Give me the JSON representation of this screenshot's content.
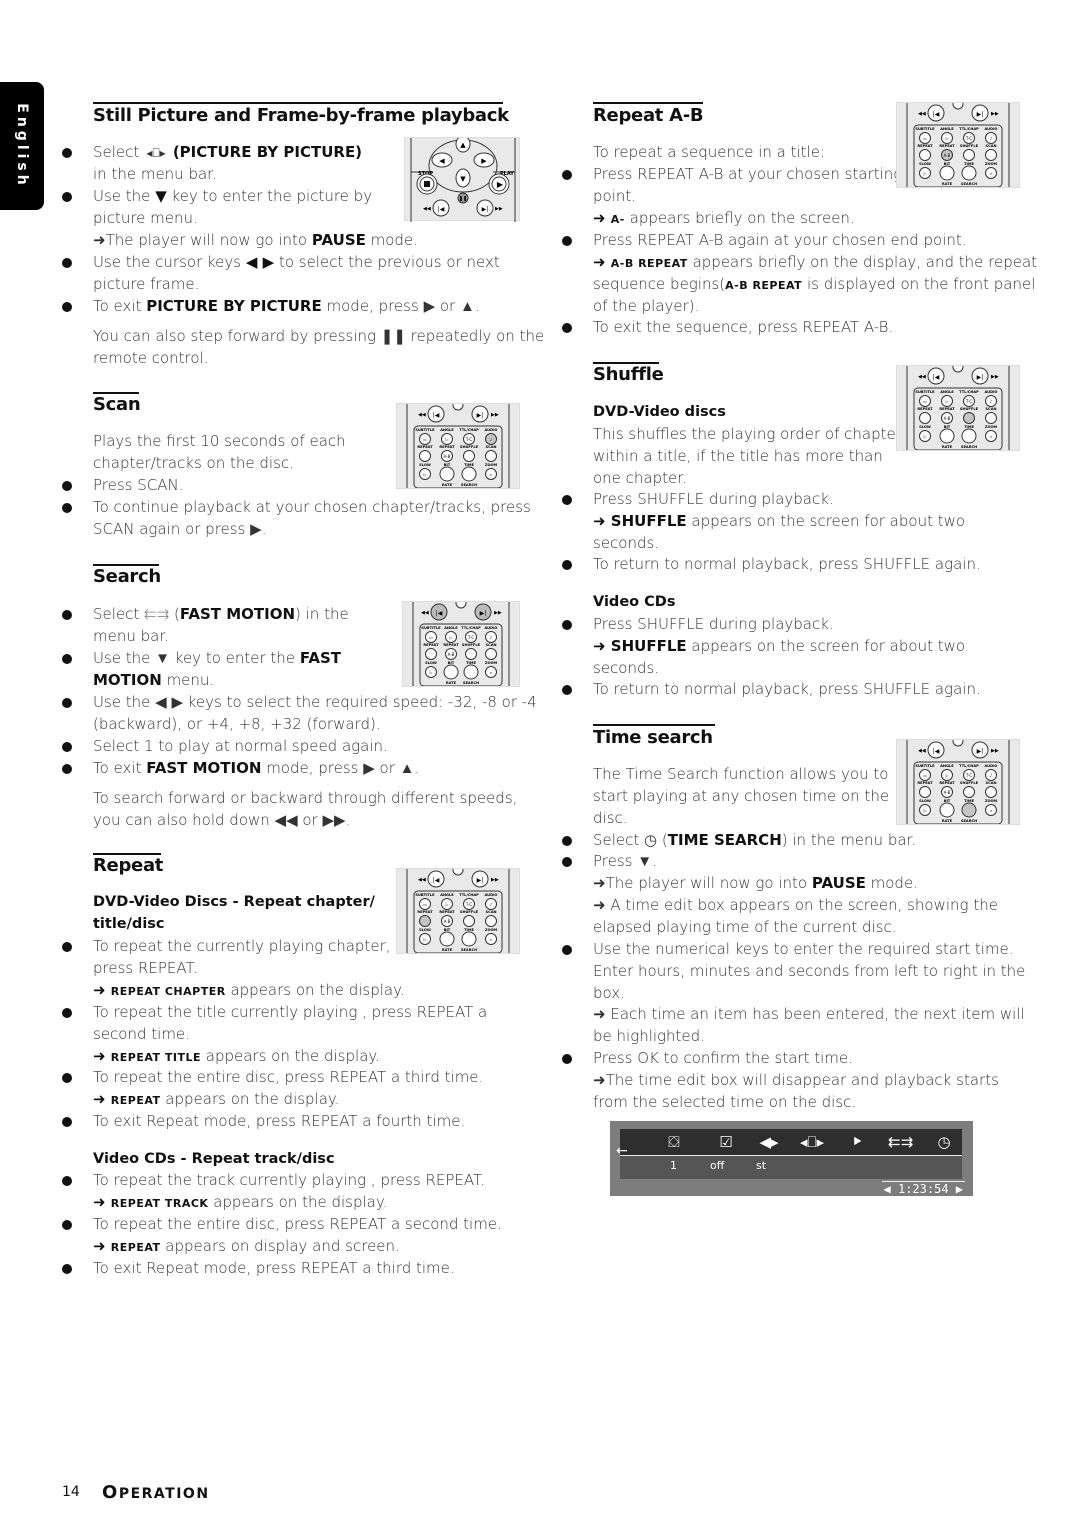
{
  "language_tab": "English",
  "footer": {
    "page_number": "14",
    "section_first": "O",
    "section_rest": "PERATION"
  },
  "still_picture": {
    "title": "Still Picture and Frame-by-frame playback",
    "lines": [
      {
        "pre": "Select ",
        "icon": "picture-by-picture-icon",
        "bold": "(PICTURE BY PICTURE)",
        "post": ""
      },
      {
        "text": "in the menu bar."
      },
      {
        "pre": "Use the ",
        "sym": "▼",
        "post": " key to enter the picture by"
      },
      {
        "text": "picture menu."
      },
      {
        "pre": "➜The player will now go into ",
        "bold": "PAUSE",
        "post": " mode."
      },
      {
        "pre": "Use the cursor keys ",
        "sym": "◀ ▶",
        "post": " to select the previous or next"
      },
      {
        "text": "picture frame."
      },
      {
        "pre": "To exit ",
        "bold": "PICTURE BY PICTURE",
        "post": " mode, press ▶ or ▲."
      },
      {
        "text": "You can also step forward by pressing ❚❚ repeatedly on the"
      },
      {
        "text": "remote control."
      }
    ],
    "remote_labels": {
      "stop": "STOP",
      "play": "PLAY"
    }
  },
  "scan": {
    "title": "Scan",
    "lines": [
      "Plays the first 10 seconds of each",
      "chapter/tracks on the disc.",
      "Press SCAN.",
      "To continue playback at your chosen chapter/tracks, press",
      "SCAN again or press ▶."
    ]
  },
  "search": {
    "title": "Search",
    "l1_pre": "Select ",
    "l1_bold": "FAST MOTION",
    "l1_post": ") in the",
    "l2": "menu bar.",
    "l3_pre": "Use the ▼ key to enter the ",
    "l3_bold": "FAST",
    "l4_bold": "MOTION",
    "l4_post": " menu.",
    "l5": "Use the ◀ ▶ keys to select the required speed: -32, -8 or -4",
    "l6": "(backward), or +4, +8, +32 (forward).",
    "l7": "Select 1 to play at normal speed again.",
    "l8_pre": "To exit ",
    "l8_bold": "FAST MOTION",
    "l8_post": " mode, press ▶ or ▲.",
    "l9": "To search forward or backward through different speeds,",
    "l10": "you can also hold down ◀◀ or ▶▶."
  },
  "repeat": {
    "title": "Repeat",
    "sub1_a": "DVD-Video Discs - Repeat chapter/",
    "sub1_b": "title/disc",
    "l1": "To repeat the currently playing chapter,",
    "l2": "press REPEAT.",
    "l3_sc": "REPEAT CHAPTER",
    "l3_post": " appears on the display.",
    "l4": "To repeat the title currently playing , press REPEAT a",
    "l5": "second time.",
    "l6_sc": "REPEAT TITLE",
    "l6_post": " appears on the display.",
    "l7": "To repeat the entire disc, press REPEAT a third time.",
    "l8_sc": "REPEAT",
    "l8_post": " appears on the display.",
    "l9": "To exit Repeat mode, press REPEAT a fourth time.",
    "sub2": "Video CDs - Repeat track/disc",
    "m1": "To repeat the track currently playing , press REPEAT.",
    "m2_sc": "REPEAT TRACK",
    "m2_post": " appears on the display.",
    "m3": "To repeat the entire disc, press REPEAT a second time.",
    "m4_sc": "REPEAT",
    "m4_post": " appears on display and screen.",
    "m5": "To exit Repeat mode, press REPEAT a third time."
  },
  "repeat_ab": {
    "title": "Repeat A-B",
    "l1": "To repeat a sequence in a title:",
    "l2": "Press REPEAT A-B at your chosen starting",
    "l3": "point.",
    "l4_sc": "A-",
    "l4_post": " appears briefly on the screen.",
    "l5": "Press REPEAT A-B again at your chosen end point.",
    "l6_sc": "A-B REPEAT",
    "l6_post": " appears briefly on the display, and the repeat",
    "l7_pre": "sequence begins(",
    "l7_sc": "A-B REPEAT",
    "l7_post": " is displayed on the front panel",
    "l8": "of the player).",
    "l9": "To exit the sequence, press REPEAT A-B."
  },
  "shuffle": {
    "title": "Shuffle",
    "sub1": "DVD-Video discs",
    "l1": "This shuffles the playing order of chapters",
    "l2": "within a title, if the title has more than",
    "l3": "one chapter.",
    "l4": "Press SHUFFLE during playback.",
    "l5_bold": "SHUFFLE",
    "l5_post": " appears on the screen for about two",
    "l6": "seconds.",
    "l7": "To return to normal playback, press SHUFFLE again.",
    "sub2": "Video CDs",
    "m1": "Press SHUFFLE during playback.",
    "m2_bold": "SHUFFLE",
    "m2_post": " appears on the screen for about two",
    "m3": "seconds.",
    "m4": "To return to normal playback, press SHUFFLE again."
  },
  "time_search": {
    "title": "Time search",
    "l1": "The Time Search function allows you to",
    "l2": "start playing at any chosen time on the",
    "l3": "disc.",
    "l4_pre": "Select ",
    "l4_bold": "TIME SEARCH",
    "l4_post": ") in the menu bar.",
    "l5": "Press ▼.",
    "l6_pre": "➜The player will now go into ",
    "l6_bold": "PAUSE",
    "l6_post": " mode.",
    "l7": "➜ A time edit box appears on the screen, showing the",
    "l8": "elapsed playing time of the current disc.",
    "l9": "Use the numerical keys to enter the required start time.",
    "l10": "Enter hours, minutes and seconds from left to right in the",
    "l11": "box.",
    "l12": "➜ Each time an item has been entered, the next item will",
    "l13": "be highlighted.",
    "l14": "Press OK to confirm the start time.",
    "l15": "➜The time edit box will disappear and playback starts",
    "l16": "from the selected time on the disc."
  },
  "osd": {
    "values": [
      "1",
      "off",
      "st"
    ],
    "time": "1:23:54",
    "icons": [
      "subtitle-icon",
      "check-icon",
      "audio-icon",
      "picture-by-picture-icon",
      "slow-motion-icon",
      "fast-motion-icon",
      "time-search-icon"
    ]
  },
  "remote": {
    "row1": [
      "SUBTITLE",
      "ANGLE",
      "TTL/CHAP",
      "AUDIO"
    ],
    "row2": [
      "REPEAT",
      "REPEAT",
      "SHUFFLE",
      "SCAN"
    ],
    "row3": [
      "SLOW",
      "BIT",
      "TIME",
      "ZOOM"
    ],
    "row4": [
      "RATE",
      "SEARCH"
    ],
    "ab": "A-B",
    "tc": "T-C"
  }
}
